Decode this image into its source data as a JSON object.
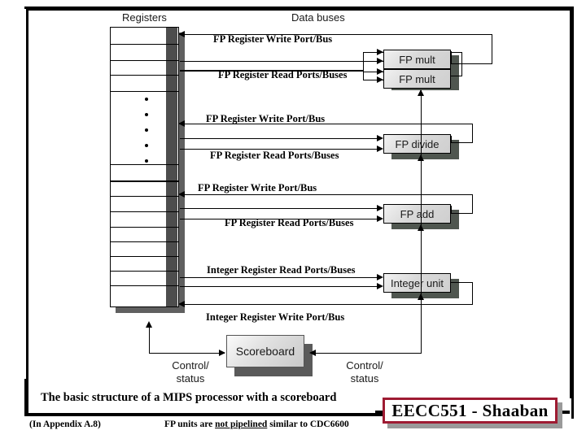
{
  "diagram": {
    "headers": {
      "registers": "Registers",
      "data_buses": "Data buses"
    },
    "bus_labels": {
      "fp_write_1": "FP Register Write Port/Bus",
      "fp_read_1": "FP Register Read Ports/Buses",
      "fp_write_2": "FP Register Write Port/Bus",
      "fp_read_2": "FP Register Read Ports/Buses",
      "fp_write_3": "FP Register Write Port/Bus",
      "fp_read_3": "FP Register Read Ports/Buses",
      "int_read": "Integer Register Read Ports/Buses",
      "int_write": "Integer Register Write Port/Bus"
    },
    "units": [
      {
        "label": "FP mult"
      },
      {
        "label": "FP mult"
      },
      {
        "label": "FP divide"
      },
      {
        "label": "FP add"
      },
      {
        "label": "Integer unit"
      }
    ],
    "scoreboard": {
      "label": "Scoreboard"
    },
    "control_left": "Control/\nstatus",
    "control_left_line1": "Control/",
    "control_left_line2": "status",
    "control_right_line1": "Control/",
    "control_right_line2": "status"
  },
  "footer": {
    "caption": "The basic structure of a MIPS processor with a scoreboard",
    "appendix_note": "(In  Appendix A.8)",
    "fp_note_pre": "FP units are ",
    "fp_note_underline": "not pipelined",
    "fp_note_post": " similar to CDC6600",
    "badge": "EECC551 - Shaaban"
  },
  "colors": {
    "badge_border": "#9e1b32",
    "unit_fill": "#d9d9d9",
    "unit_shadow": "#4f564f",
    "register_band": "#4d4d4d",
    "line": "#000000"
  }
}
